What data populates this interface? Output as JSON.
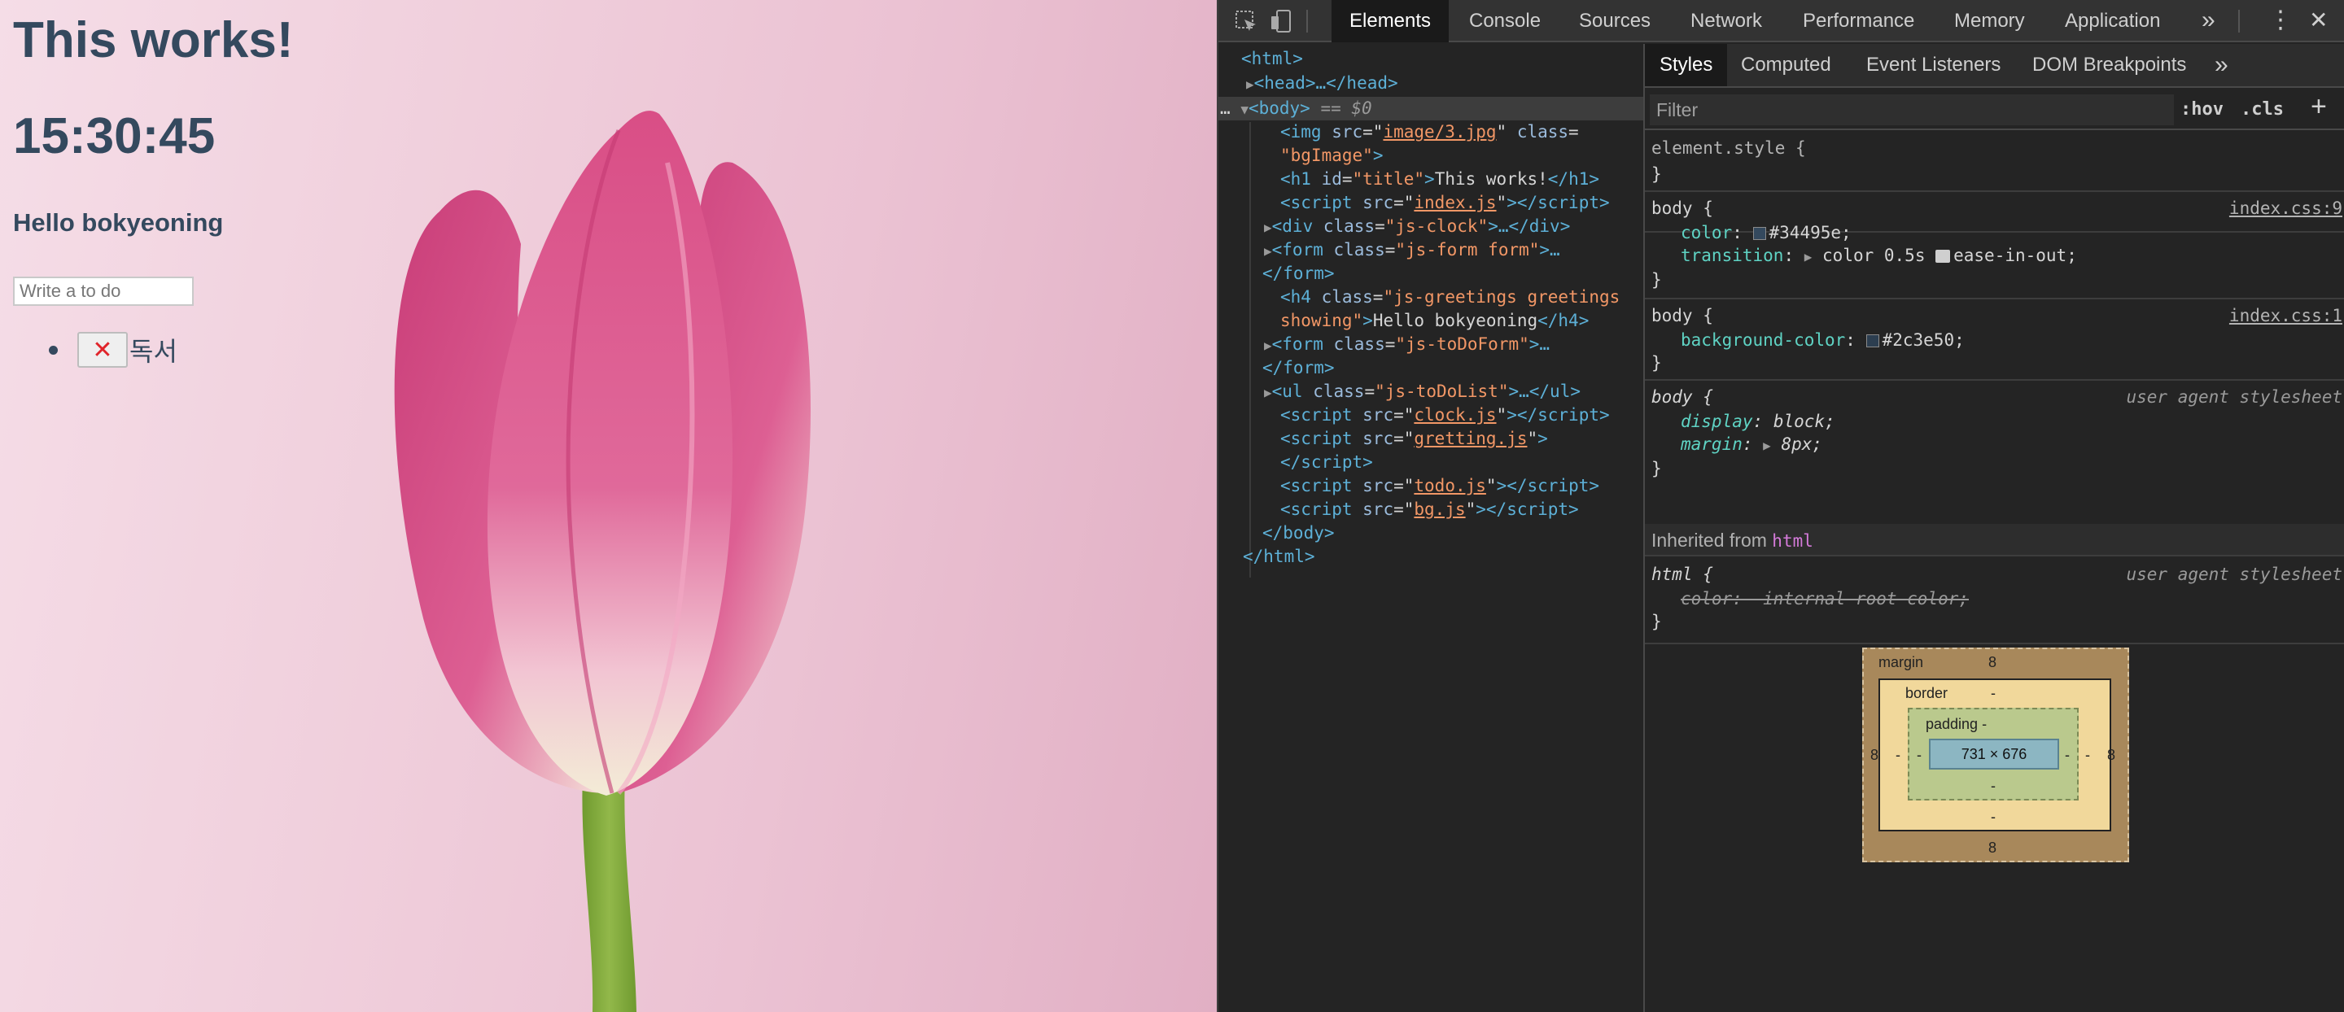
{
  "page": {
    "title": "This works!",
    "clock": "15:30:45",
    "greeting": "Hello bokyeoning",
    "todo_placeholder": "Write a to do",
    "todos": [
      {
        "delete_glyph": "✕",
        "text": "독서"
      }
    ],
    "colors": {
      "text": "#34495e",
      "delete_x": "#e0252b"
    }
  },
  "devtools": {
    "main_tabs": [
      "Elements",
      "Console",
      "Sources",
      "Network",
      "Performance",
      "Memory",
      "Application"
    ],
    "more_glyph": "»",
    "menu_glyph": "⋮",
    "close_glyph": "✕",
    "dom": {
      "html_open": "<html>",
      "head_line": "<head>…</head>",
      "dots": "…",
      "body_open": "<body>",
      "body_eq": "== $0",
      "img_src": "image/3.jpg",
      "img_class": "bgImage",
      "h1_text": "This works!",
      "script_index": "index.js",
      "div_class": "js-clock",
      "form_class": "js-form form",
      "h4_class_1": "js-greetings greetings",
      "h4_class_2": "showing",
      "h4_text": "Hello bokyeoning",
      "todo_form_class": "js-toDoForm",
      "ul_class": "js-toDoList",
      "script_clock": "clock.js",
      "script_greeting": "gretting.js",
      "script_todo": "todo.js",
      "script_bg": "bg.js"
    },
    "sub_tabs": [
      "Styles",
      "Computed",
      "Event Listeners",
      "DOM Breakpoints"
    ],
    "filter_placeholder": "Filter",
    "hov": ":hov",
    "cls": ".cls",
    "plus": "+",
    "rules": {
      "element_style": "element.style {",
      "r1_selector": "body {",
      "r1_source": "index.css:9",
      "r1_color_prop": "color",
      "r1_color_val": "#34495e;",
      "r1_transition_prop": "transition",
      "r1_transition_val_a": "color 0.5s",
      "r1_transition_val_b": "ease-in-out;",
      "r2_selector": "body {",
      "r2_source": "index.css:1",
      "r2_prop": "background-color",
      "r2_val": "#2c3e50;",
      "r3_selector": "body {",
      "r3_source": "user agent stylesheet",
      "r3_display_prop": "display",
      "r3_display_val": "block;",
      "r3_margin_prop": "margin",
      "r3_margin_val": "8px;",
      "inherited_label": "Inherited from",
      "inherited_tag": "html",
      "r4_selector": "html {",
      "r4_source": "user agent stylesheet",
      "r4_struck": "color: -internal-root-color;",
      "close_brace": "}",
      "swatch_colors": [
        "#34495e",
        "#2c3e50"
      ]
    },
    "box_model": {
      "margin_label": "margin",
      "margin_value": "8",
      "border_label": "border",
      "border_value": "-",
      "padding_label": "padding -",
      "padding_value": "-",
      "content": "731 × 676"
    }
  }
}
